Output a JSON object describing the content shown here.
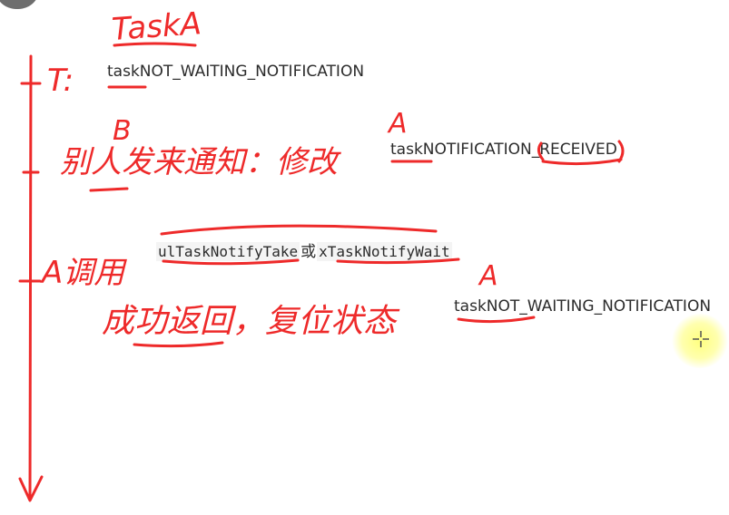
{
  "lines": {
    "line1": "taskNOT_WAITING_NOTIFICATION",
    "line2": "taskNOTIFICATION_RECEIVED",
    "line3_a": "ulTaskNotifyTake",
    "line3_b": "或",
    "line3_c": "xTaskNotifyWait",
    "line4": "taskNOT_WAITING_NOTIFICATION"
  },
  "handwriting": {
    "title": "TaskA",
    "t_label": "T:",
    "b_mark": "B",
    "row2": "别人发来通知：修改",
    "a_mark_1": "A",
    "row3_prefix": "A调用",
    "a_mark_2": "A",
    "row4": "成功返回，复位状态"
  },
  "colors": {
    "ink": "#ee2a2a",
    "text": "#2b2b2b",
    "highlight": "#ffff78"
  }
}
